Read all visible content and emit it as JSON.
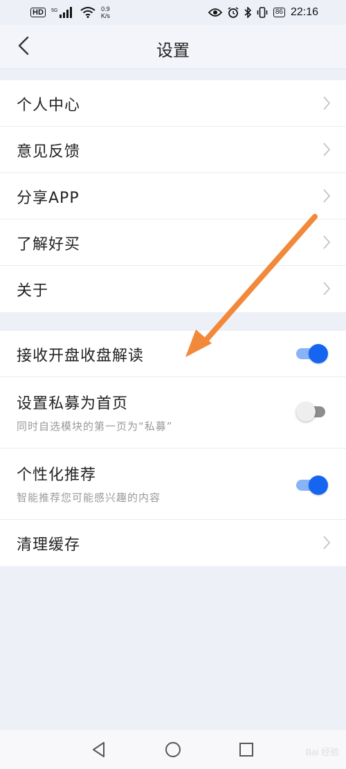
{
  "status_bar": {
    "hd_label": "HD",
    "network_type": "5G",
    "speed_value": "0.9",
    "speed_unit": "K/s",
    "battery": "86",
    "time": "22:16"
  },
  "header": {
    "title": "设置",
    "back_icon": "chevron-left-icon"
  },
  "menu_group_1": [
    {
      "label": "个人中心"
    },
    {
      "label": "意见反馈"
    },
    {
      "label": "分享APP"
    },
    {
      "label": "了解好买"
    },
    {
      "label": "关于"
    }
  ],
  "settings_group_2": {
    "market_interpretation": {
      "label": "接收开盘收盘解读",
      "enabled": true
    },
    "private_fund_home": {
      "label": "设置私募为首页",
      "sub": "同时自选模块的第一页为“私募”",
      "enabled": false
    },
    "personalized_recommend": {
      "label": "个性化推荐",
      "sub": "智能推荐您可能感兴趣的内容",
      "enabled": true
    },
    "clear_cache": {
      "label": "清理缓存"
    }
  },
  "annotation": {
    "arrow_color": "#f2883a"
  },
  "colors": {
    "accent": "#1565f0",
    "toggle_track_on": "#87b3f7"
  },
  "watermark": "Bai 经验"
}
